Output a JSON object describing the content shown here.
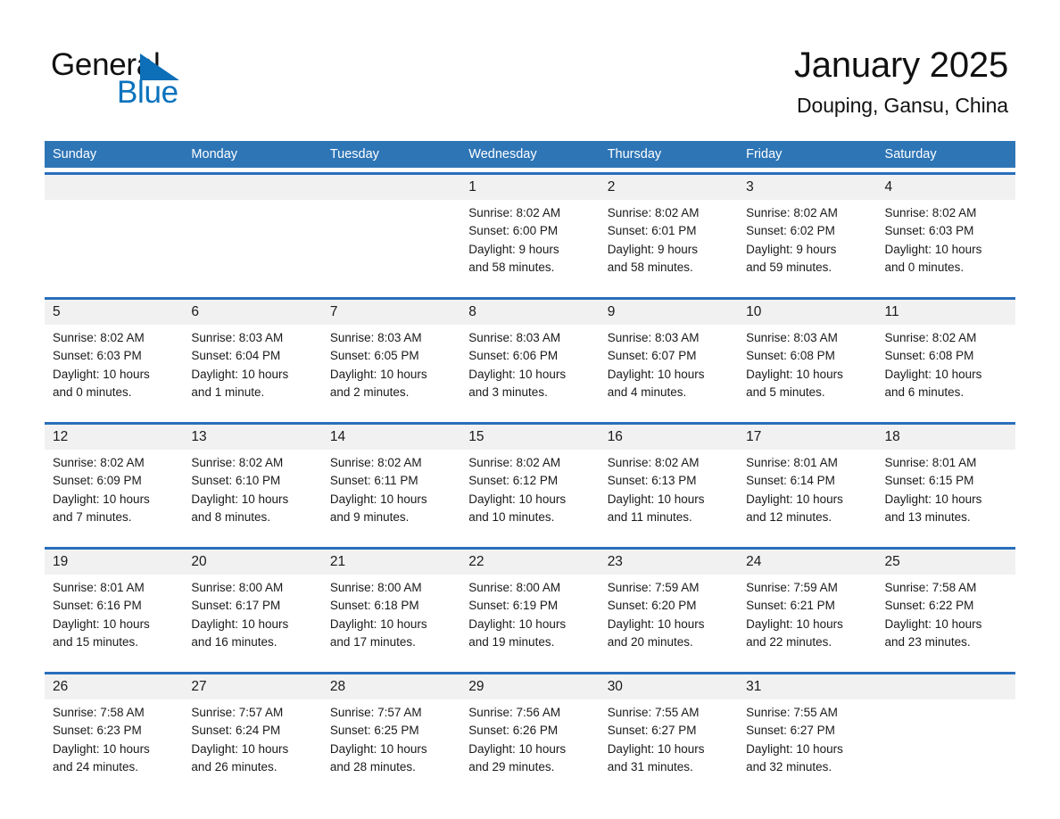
{
  "brand": {
    "name_part1": "General",
    "name_part2": "Blue",
    "triangle_color": "#0d6fb8",
    "text_color": "#111111",
    "blue_text_color": "#0a72bd"
  },
  "header": {
    "title": "January 2025",
    "subtitle": "Douping, Gansu, China"
  },
  "theme": {
    "header_blue": "#2e75b6",
    "row_rule_blue": "#2a6ebb",
    "number_band_gray": "#f1f1f1",
    "page_background": "#ffffff"
  },
  "weekdays": [
    {
      "label": "Sunday"
    },
    {
      "label": "Monday"
    },
    {
      "label": "Tuesday"
    },
    {
      "label": "Wednesday"
    },
    {
      "label": "Thursday"
    },
    {
      "label": "Friday"
    },
    {
      "label": "Saturday"
    }
  ],
  "weeks": [
    {
      "days": [
        {
          "num": "",
          "sunrise": "",
          "sunset": "",
          "daylight1": "",
          "daylight2": "",
          "empty": true
        },
        {
          "num": "",
          "sunrise": "",
          "sunset": "",
          "daylight1": "",
          "daylight2": "",
          "empty": true
        },
        {
          "num": "",
          "sunrise": "",
          "sunset": "",
          "daylight1": "",
          "daylight2": "",
          "empty": true
        },
        {
          "num": "1",
          "sunrise": "Sunrise: 8:02 AM",
          "sunset": "Sunset: 6:00 PM",
          "daylight1": "Daylight: 9 hours",
          "daylight2": "and 58 minutes.",
          "empty": false
        },
        {
          "num": "2",
          "sunrise": "Sunrise: 8:02 AM",
          "sunset": "Sunset: 6:01 PM",
          "daylight1": "Daylight: 9 hours",
          "daylight2": "and 58 minutes.",
          "empty": false
        },
        {
          "num": "3",
          "sunrise": "Sunrise: 8:02 AM",
          "sunset": "Sunset: 6:02 PM",
          "daylight1": "Daylight: 9 hours",
          "daylight2": "and 59 minutes.",
          "empty": false
        },
        {
          "num": "4",
          "sunrise": "Sunrise: 8:02 AM",
          "sunset": "Sunset: 6:03 PM",
          "daylight1": "Daylight: 10 hours",
          "daylight2": "and 0 minutes.",
          "empty": false
        }
      ]
    },
    {
      "days": [
        {
          "num": "5",
          "sunrise": "Sunrise: 8:02 AM",
          "sunset": "Sunset: 6:03 PM",
          "daylight1": "Daylight: 10 hours",
          "daylight2": "and 0 minutes.",
          "empty": false
        },
        {
          "num": "6",
          "sunrise": "Sunrise: 8:03 AM",
          "sunset": "Sunset: 6:04 PM",
          "daylight1": "Daylight: 10 hours",
          "daylight2": "and 1 minute.",
          "empty": false
        },
        {
          "num": "7",
          "sunrise": "Sunrise: 8:03 AM",
          "sunset": "Sunset: 6:05 PM",
          "daylight1": "Daylight: 10 hours",
          "daylight2": "and 2 minutes.",
          "empty": false
        },
        {
          "num": "8",
          "sunrise": "Sunrise: 8:03 AM",
          "sunset": "Sunset: 6:06 PM",
          "daylight1": "Daylight: 10 hours",
          "daylight2": "and 3 minutes.",
          "empty": false
        },
        {
          "num": "9",
          "sunrise": "Sunrise: 8:03 AM",
          "sunset": "Sunset: 6:07 PM",
          "daylight1": "Daylight: 10 hours",
          "daylight2": "and 4 minutes.",
          "empty": false
        },
        {
          "num": "10",
          "sunrise": "Sunrise: 8:03 AM",
          "sunset": "Sunset: 6:08 PM",
          "daylight1": "Daylight: 10 hours",
          "daylight2": "and 5 minutes.",
          "empty": false
        },
        {
          "num": "11",
          "sunrise": "Sunrise: 8:02 AM",
          "sunset": "Sunset: 6:08 PM",
          "daylight1": "Daylight: 10 hours",
          "daylight2": "and 6 minutes.",
          "empty": false
        }
      ]
    },
    {
      "days": [
        {
          "num": "12",
          "sunrise": "Sunrise: 8:02 AM",
          "sunset": "Sunset: 6:09 PM",
          "daylight1": "Daylight: 10 hours",
          "daylight2": "and 7 minutes.",
          "empty": false
        },
        {
          "num": "13",
          "sunrise": "Sunrise: 8:02 AM",
          "sunset": "Sunset: 6:10 PM",
          "daylight1": "Daylight: 10 hours",
          "daylight2": "and 8 minutes.",
          "empty": false
        },
        {
          "num": "14",
          "sunrise": "Sunrise: 8:02 AM",
          "sunset": "Sunset: 6:11 PM",
          "daylight1": "Daylight: 10 hours",
          "daylight2": "and 9 minutes.",
          "empty": false
        },
        {
          "num": "15",
          "sunrise": "Sunrise: 8:02 AM",
          "sunset": "Sunset: 6:12 PM",
          "daylight1": "Daylight: 10 hours",
          "daylight2": "and 10 minutes.",
          "empty": false
        },
        {
          "num": "16",
          "sunrise": "Sunrise: 8:02 AM",
          "sunset": "Sunset: 6:13 PM",
          "daylight1": "Daylight: 10 hours",
          "daylight2": "and 11 minutes.",
          "empty": false
        },
        {
          "num": "17",
          "sunrise": "Sunrise: 8:01 AM",
          "sunset": "Sunset: 6:14 PM",
          "daylight1": "Daylight: 10 hours",
          "daylight2": "and 12 minutes.",
          "empty": false
        },
        {
          "num": "18",
          "sunrise": "Sunrise: 8:01 AM",
          "sunset": "Sunset: 6:15 PM",
          "daylight1": "Daylight: 10 hours",
          "daylight2": "and 13 minutes.",
          "empty": false
        }
      ]
    },
    {
      "days": [
        {
          "num": "19",
          "sunrise": "Sunrise: 8:01 AM",
          "sunset": "Sunset: 6:16 PM",
          "daylight1": "Daylight: 10 hours",
          "daylight2": "and 15 minutes.",
          "empty": false
        },
        {
          "num": "20",
          "sunrise": "Sunrise: 8:00 AM",
          "sunset": "Sunset: 6:17 PM",
          "daylight1": "Daylight: 10 hours",
          "daylight2": "and 16 minutes.",
          "empty": false
        },
        {
          "num": "21",
          "sunrise": "Sunrise: 8:00 AM",
          "sunset": "Sunset: 6:18 PM",
          "daylight1": "Daylight: 10 hours",
          "daylight2": "and 17 minutes.",
          "empty": false
        },
        {
          "num": "22",
          "sunrise": "Sunrise: 8:00 AM",
          "sunset": "Sunset: 6:19 PM",
          "daylight1": "Daylight: 10 hours",
          "daylight2": "and 19 minutes.",
          "empty": false
        },
        {
          "num": "23",
          "sunrise": "Sunrise: 7:59 AM",
          "sunset": "Sunset: 6:20 PM",
          "daylight1": "Daylight: 10 hours",
          "daylight2": "and 20 minutes.",
          "empty": false
        },
        {
          "num": "24",
          "sunrise": "Sunrise: 7:59 AM",
          "sunset": "Sunset: 6:21 PM",
          "daylight1": "Daylight: 10 hours",
          "daylight2": "and 22 minutes.",
          "empty": false
        },
        {
          "num": "25",
          "sunrise": "Sunrise: 7:58 AM",
          "sunset": "Sunset: 6:22 PM",
          "daylight1": "Daylight: 10 hours",
          "daylight2": "and 23 minutes.",
          "empty": false
        }
      ]
    },
    {
      "days": [
        {
          "num": "26",
          "sunrise": "Sunrise: 7:58 AM",
          "sunset": "Sunset: 6:23 PM",
          "daylight1": "Daylight: 10 hours",
          "daylight2": "and 24 minutes.",
          "empty": false
        },
        {
          "num": "27",
          "sunrise": "Sunrise: 7:57 AM",
          "sunset": "Sunset: 6:24 PM",
          "daylight1": "Daylight: 10 hours",
          "daylight2": "and 26 minutes.",
          "empty": false
        },
        {
          "num": "28",
          "sunrise": "Sunrise: 7:57 AM",
          "sunset": "Sunset: 6:25 PM",
          "daylight1": "Daylight: 10 hours",
          "daylight2": "and 28 minutes.",
          "empty": false
        },
        {
          "num": "29",
          "sunrise": "Sunrise: 7:56 AM",
          "sunset": "Sunset: 6:26 PM",
          "daylight1": "Daylight: 10 hours",
          "daylight2": "and 29 minutes.",
          "empty": false
        },
        {
          "num": "30",
          "sunrise": "Sunrise: 7:55 AM",
          "sunset": "Sunset: 6:27 PM",
          "daylight1": "Daylight: 10 hours",
          "daylight2": "and 31 minutes.",
          "empty": false
        },
        {
          "num": "31",
          "sunrise": "Sunrise: 7:55 AM",
          "sunset": "Sunset: 6:27 PM",
          "daylight1": "Daylight: 10 hours",
          "daylight2": "and 32 minutes.",
          "empty": false
        },
        {
          "num": "",
          "sunrise": "",
          "sunset": "",
          "daylight1": "",
          "daylight2": "",
          "empty": true
        }
      ]
    }
  ]
}
